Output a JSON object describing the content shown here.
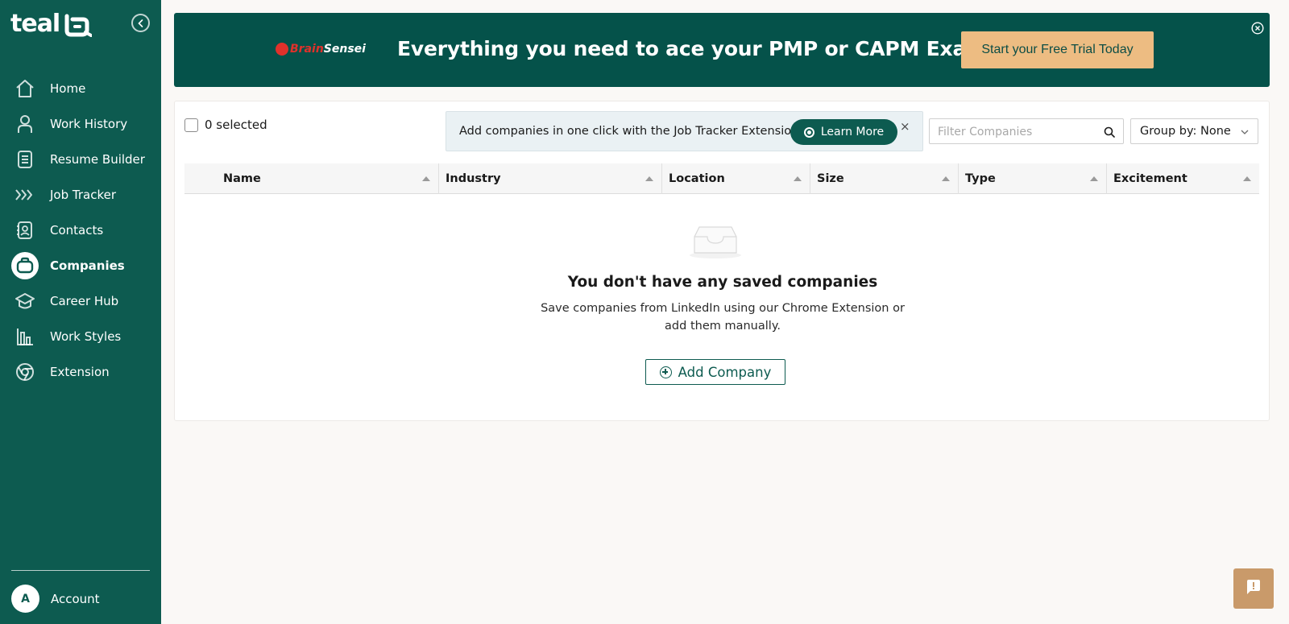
{
  "sidebar": {
    "logo_text": "teal",
    "items": [
      {
        "label": "Home",
        "icon": "home-icon"
      },
      {
        "label": "Work History",
        "icon": "person-icon"
      },
      {
        "label": "Resume Builder",
        "icon": "document-icon"
      },
      {
        "label": "Job Tracker",
        "icon": "chevrons-right-icon"
      },
      {
        "label": "Contacts",
        "icon": "contact-card-icon"
      },
      {
        "label": "Companies",
        "icon": "briefcase-icon",
        "active": true
      },
      {
        "label": "Career Hub",
        "icon": "graduation-cap-icon"
      },
      {
        "label": "Work Styles",
        "icon": "bar-chart-icon"
      },
      {
        "label": "Extension",
        "icon": "chrome-icon"
      }
    ],
    "account": {
      "initial": "A",
      "label": "Account"
    }
  },
  "banner": {
    "brand_part1": "Brain",
    "brand_part2": "Sensei",
    "headline": "Everything you need to ace your PMP or CAPM Exams",
    "cta_label": "Start your Free Trial Today"
  },
  "toolbar": {
    "selected_label": "0 selected",
    "extension_text": "Add companies in one click with the Job Tracker Extension",
    "learn_more_label": "Learn More",
    "close_glyph": "×",
    "filter_placeholder": "Filter Companies",
    "group_by_label": "Group by: None"
  },
  "table": {
    "columns": [
      "Name",
      "Industry",
      "Location",
      "Size",
      "Type",
      "Excitement"
    ]
  },
  "empty_state": {
    "title": "You don't have any saved companies",
    "description": "Save companies from LinkedIn using our Chrome Extension or add them manually.",
    "button_label": "Add Company"
  },
  "colors": {
    "sidebar_bg": "#0d5b50",
    "banner_bg": "#05524a",
    "cta_bg": "#edbc82",
    "feedback_bg": "#c99a6a"
  }
}
